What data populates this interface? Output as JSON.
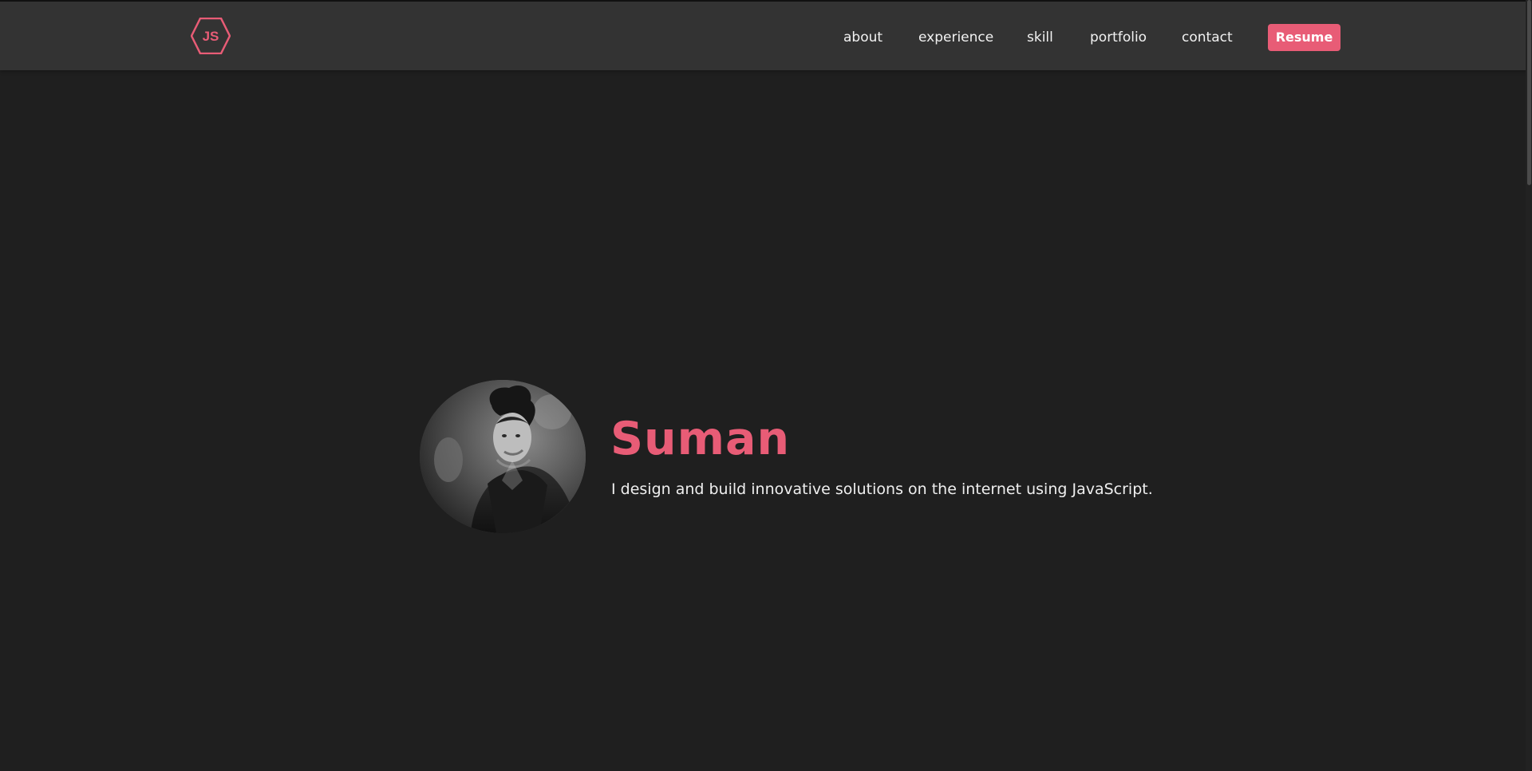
{
  "brand": {
    "logo_text": "JS",
    "logo_icon": "hexagon-icon",
    "accent_color": "#e85c76"
  },
  "navigation": {
    "items": [
      {
        "label": "about"
      },
      {
        "label": "experience"
      },
      {
        "label": "skill"
      },
      {
        "label": "portfolio"
      },
      {
        "label": "contact"
      }
    ],
    "resume_label": "Resume"
  },
  "hero": {
    "name": "Suman",
    "tagline": "I design and build innovative solutions on the internet using JavaScript."
  },
  "theme": {
    "background": "#1f1f1f",
    "header_background": "#333333",
    "text_color": "#efefef"
  }
}
